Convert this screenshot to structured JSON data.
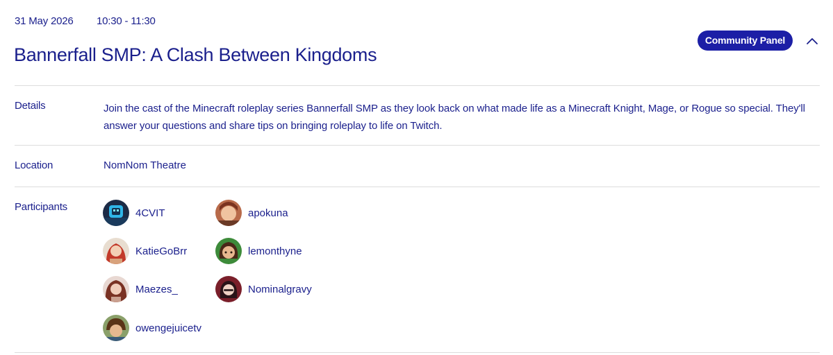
{
  "event": {
    "date": "31 May 2026",
    "time": "10:30 - 11:30",
    "title": "Bannerfall SMP: A Clash Between Kingdoms",
    "badge": "Community Panel",
    "collapse_icon": "chevron-up-icon"
  },
  "sections": {
    "details_label": "Details",
    "details_text": "Join the cast of the Minecraft roleplay series Bannerfall SMP as they look back on what made life as a Minecraft Knight, Mage, or Rogue so special. They'll answer your questions and share tips on bringing roleplay to life on Twitch.",
    "location_label": "Location",
    "location_text": "NomNom Theatre",
    "participants_label": "Participants"
  },
  "participants": [
    {
      "name": "4CVIT"
    },
    {
      "name": "apokuna"
    },
    {
      "name": "KatieGoBrr"
    },
    {
      "name": "lemonthyne"
    },
    {
      "name": "Maezes_"
    },
    {
      "name": "Nominalgravy"
    },
    {
      "name": "owengejuicetv"
    }
  ],
  "colors": {
    "text": "#1a1f8c",
    "badge_bg": "#1c1fa6",
    "divider": "#dcdcdc"
  }
}
